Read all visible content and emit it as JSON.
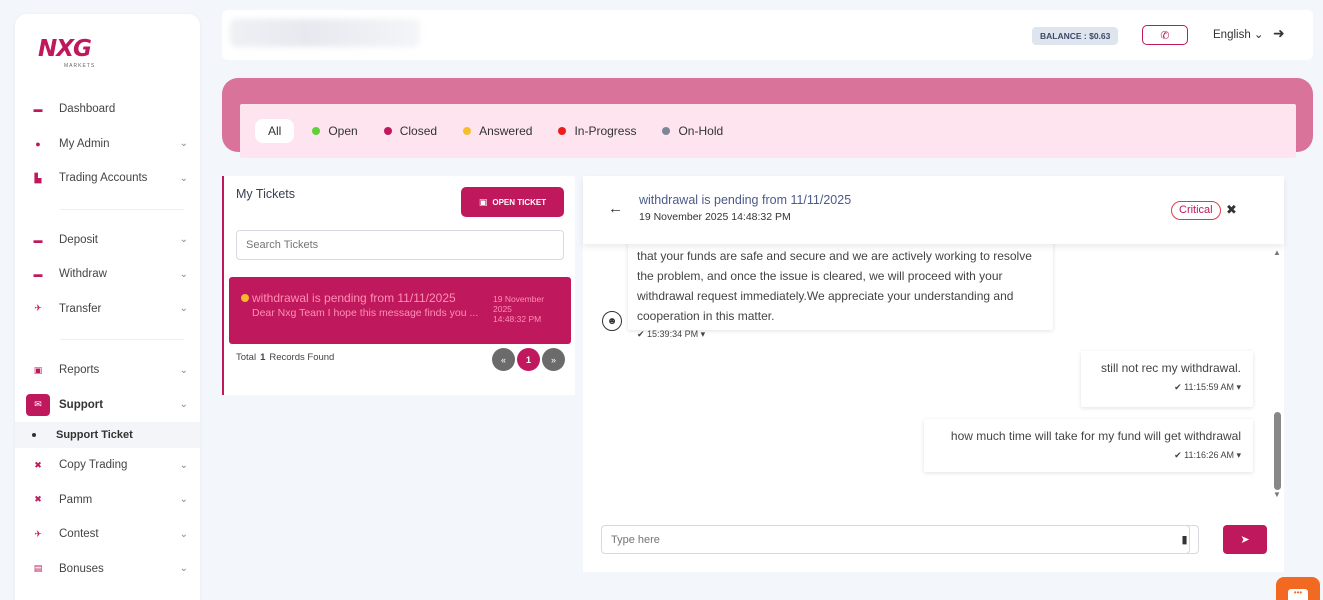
{
  "brand": {
    "logo_text": "NXG",
    "logo_sub": "MARKETS"
  },
  "sidebar": {
    "items": [
      {
        "label": "Dashboard",
        "icon": "dashboard-icon"
      },
      {
        "label": "My Admin",
        "icon": "user-icon"
      },
      {
        "label": "Trading Accounts",
        "icon": "accounts-icon"
      },
      {
        "label": "Deposit",
        "icon": "wallet-icon"
      },
      {
        "label": "Withdraw",
        "icon": "wallet-icon"
      },
      {
        "label": "Transfer",
        "icon": "transfer-icon"
      },
      {
        "label": "Reports",
        "icon": "report-icon"
      },
      {
        "label": "Support",
        "icon": "support-icon"
      },
      {
        "label": "Copy Trading",
        "icon": "tools-icon"
      },
      {
        "label": "Pamm",
        "icon": "tools-icon"
      },
      {
        "label": "Contest",
        "icon": "rocket-icon"
      },
      {
        "label": "Bonuses",
        "icon": "gift-icon"
      }
    ],
    "sub_item": "Support Ticket"
  },
  "topbar": {
    "balance": "BALANCE : $0.63",
    "language": "English",
    "phone_icon": "phone-icon",
    "logout_icon": "logout-icon"
  },
  "filters": {
    "all": "All",
    "statuses": [
      {
        "label": "Open",
        "color": "#5fcf3a"
      },
      {
        "label": "Closed",
        "color": "#c0185c"
      },
      {
        "label": "Answered",
        "color": "#f5c02e"
      },
      {
        "label": "In-Progress",
        "color": "#ee1c1c"
      },
      {
        "label": "On-Hold",
        "color": "#7d8696"
      }
    ]
  },
  "tickets": {
    "title": "My Tickets",
    "open_button": "OPEN TICKET",
    "search_placeholder": "Search Tickets",
    "items": [
      {
        "subject": "withdrawal is pending from 11/11/2025",
        "preview": "Dear Nxg Team I hope this message finds you ...",
        "date_line1": "19 November",
        "date_line2": "2025",
        "date_line3": "14:48:32 PM"
      }
    ],
    "total_label": "Total",
    "total_count": "1",
    "records_label": "Records Found",
    "pager": {
      "prev": "«",
      "current": "1",
      "next": "»"
    }
  },
  "chat": {
    "title": "withdrawal is pending from 11/11/2025",
    "date": "19 November 2025 14:48:32 PM",
    "priority": "Critical",
    "messages_in": [
      {
        "text": "that your funds are safe and secure and we are actively working to resolve the problem, and once the issue is cleared, we will proceed with your withdrawal request immediately.We appreciate your understanding and cooperation in this matter.",
        "time": "✔ 15:39:34 PM ▾"
      }
    ],
    "messages_out": [
      {
        "text": "still not rec my withdrawal.",
        "time": "✔ 11:15:59 AM ▾"
      },
      {
        "text": "how much time will take for my fund will get withdrawal",
        "time": "✔ 11:16:26 AM ▾"
      }
    ],
    "input_placeholder": "Type here"
  },
  "colors": {
    "accent": "#c0185c",
    "band": "#d9739a",
    "band_inner": "#fde4ee"
  }
}
